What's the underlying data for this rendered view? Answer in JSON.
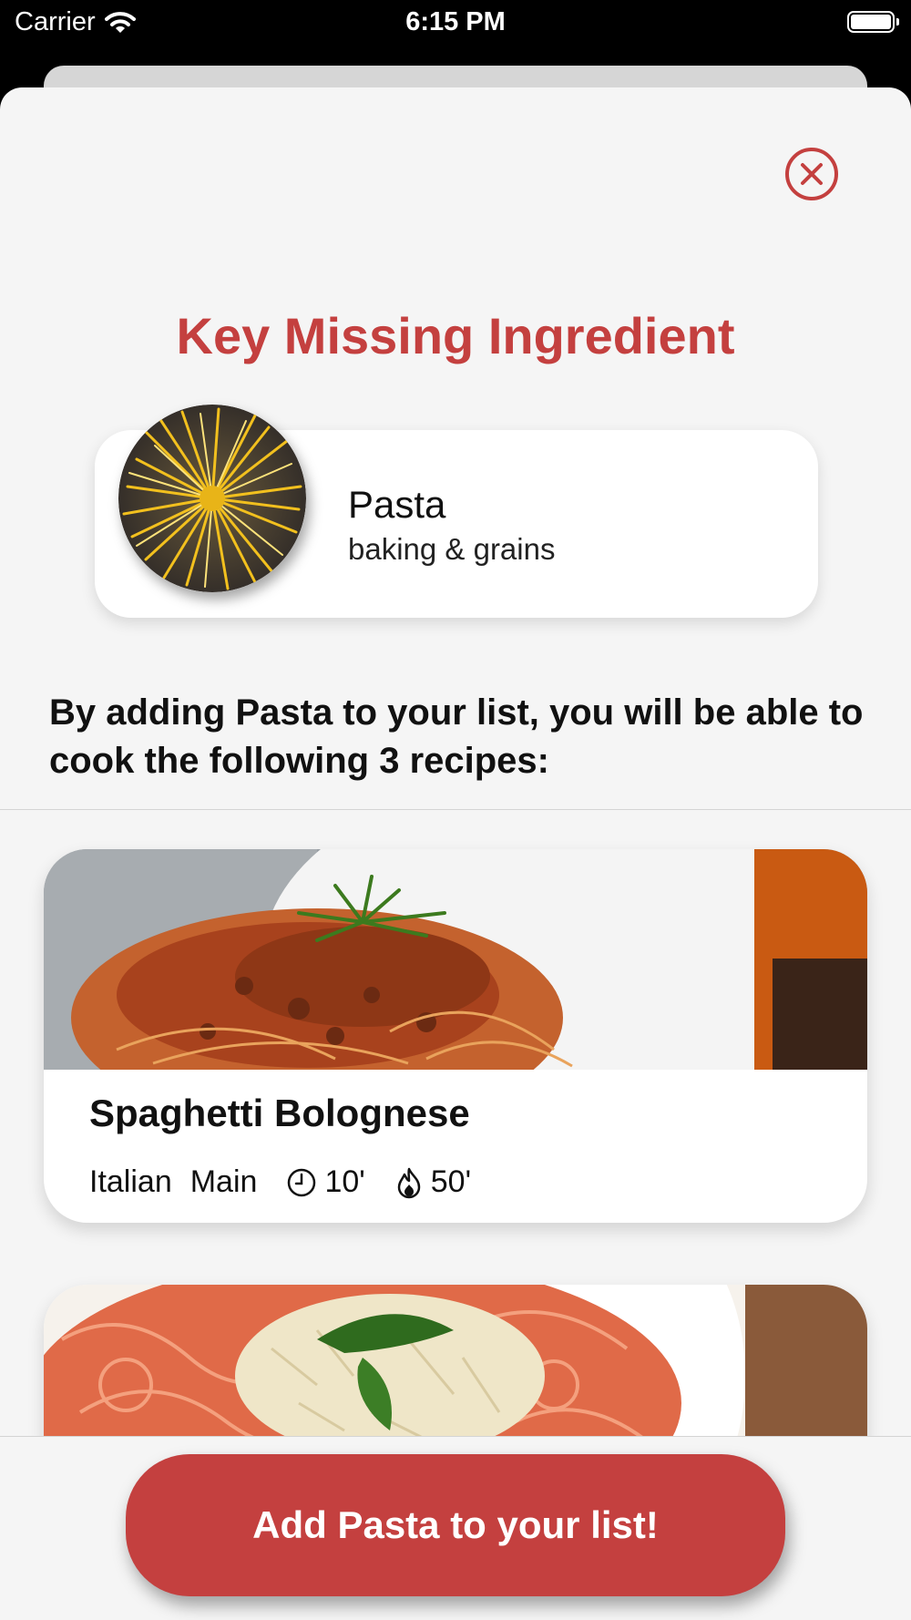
{
  "status_bar": {
    "carrier": "Carrier",
    "time": "6:15 PM"
  },
  "sheet": {
    "title": "Key Missing Ingredient",
    "ingredient": {
      "name": "Pasta",
      "category": "baking & grains"
    },
    "description": "By adding Pasta to your list, you will be able to cook the following 3 recipes:",
    "recipes": [
      {
        "title": "Spaghetti Bolognese",
        "cuisine": "Italian",
        "course": "Main",
        "prep_time": "10'",
        "cook_time": "50'"
      },
      {
        "title": "",
        "cuisine": "",
        "course": "",
        "prep_time": "",
        "cook_time": ""
      }
    ],
    "add_button_label": "Add Pasta to your list!"
  },
  "colors": {
    "accent": "#c4403f",
    "background": "#f5f5f5",
    "card": "#ffffff"
  }
}
